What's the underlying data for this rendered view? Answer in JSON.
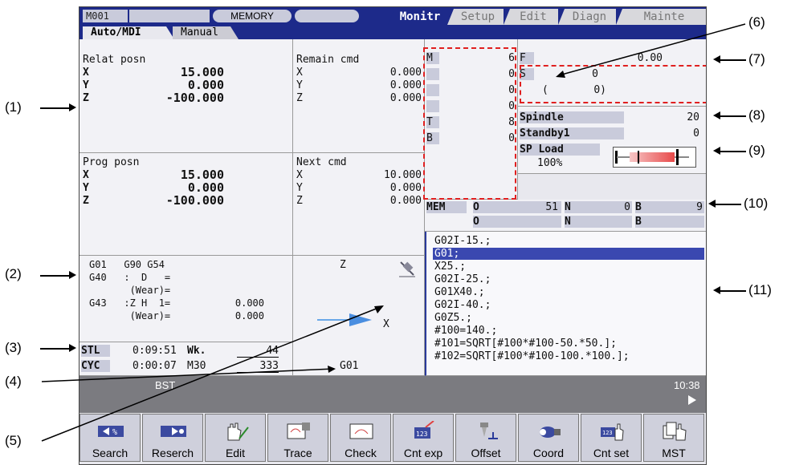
{
  "callouts": [
    "(1)",
    "(2)",
    "(3)",
    "(4)",
    "(5)",
    "(6)",
    "(7)",
    "(8)",
    "(9)",
    "(10)",
    "(11)"
  ],
  "titlebar": {
    "machine": "M001",
    "mode": "MEMORY"
  },
  "main_tabs": [
    "Monitr",
    "Setup",
    "Edit",
    "Diagn",
    "Mainte"
  ],
  "sub_tabs": [
    "Auto/MDI",
    "Manual"
  ],
  "relat": {
    "title": "Relat posn",
    "axes": [
      "X",
      "Y",
      "Z"
    ],
    "values": [
      "15.000",
      "0.000",
      "-100.000"
    ]
  },
  "remain": {
    "title": "Remain cmd",
    "axes": [
      "X",
      "Y",
      "Z"
    ],
    "values": [
      "0.000",
      "0.000",
      "0.000"
    ]
  },
  "prog": {
    "title": "Prog posn",
    "axes": [
      "X",
      "Y",
      "Z"
    ],
    "values": [
      "15.000",
      "0.000",
      "-100.000"
    ]
  },
  "next": {
    "title": "Next cmd",
    "axes": [
      "X",
      "Y",
      "Z"
    ],
    "values": [
      "10.000",
      "0.000",
      "0.000"
    ]
  },
  "modal": {
    "l1": "G01   G90 G54",
    "l2": "G40   :  D   =",
    "l3": "       (Wear)=",
    "l4": "G43   :Z H  1=",
    "l4v": "0.000",
    "l5": "       (Wear)=",
    "l5v": "0.000"
  },
  "timing": {
    "stl_label": "STL",
    "stl_time": "0:09:51",
    "wk_label": "Wk.",
    "wk_val": "44",
    "cyc_label": "CYC",
    "cyc_time": "0:00:07",
    "m30_label": "M30",
    "m30_val": "333"
  },
  "graphic": {
    "z_label": "Z",
    "x_label": "X",
    "g_label": "G01"
  },
  "mstb": {
    "labels": [
      "M",
      "",
      "",
      "",
      "T",
      "B"
    ],
    "values": [
      "6",
      "0",
      "0",
      "0",
      "8",
      "0"
    ]
  },
  "feed": {
    "f_label": "F",
    "f_val": "0.00",
    "s_label": "S",
    "s_val": "0",
    "s_paren_open": "(",
    "s_paren_val": "0)"
  },
  "spindle": {
    "label": "Spindle",
    "val": "20",
    "standby_label": "Standby1",
    "standby_val": "0",
    "load_label": "SP Load",
    "load_pct": "100%",
    "load_fraction": 0.8
  },
  "prognum": {
    "mode": "MEM",
    "o1": "O",
    "o1_val": "51",
    "n1": "N",
    "n1_val": "0",
    "b1": "B",
    "b1_val": "9",
    "o2": "O",
    "n2": "N",
    "b2": "B"
  },
  "program": [
    "G02I-15.;",
    "G01;",
    "X25.;",
    "G02I-25.;",
    "G01X40.;",
    "G02I-40.;",
    "G0Z5.;",
    "#100=140.;",
    "#101=SQRT[#100*#100-50.*50.];",
    "#102=SQRT[#100*#100-100.*100.];"
  ],
  "status": {
    "bst": "BST",
    "time": "10:38"
  },
  "fkeys": [
    "Search",
    "Reserch",
    "Edit",
    "Trace",
    "Check",
    "Cnt exp",
    "Offset",
    "Coord",
    "Cnt set",
    "MST"
  ],
  "colors": {
    "navy": "#1d2a8a",
    "panel": "#f2f2f6",
    "highlight": "#3a48b0",
    "red": "#e02020",
    "status_bar": "#7b7b80"
  }
}
